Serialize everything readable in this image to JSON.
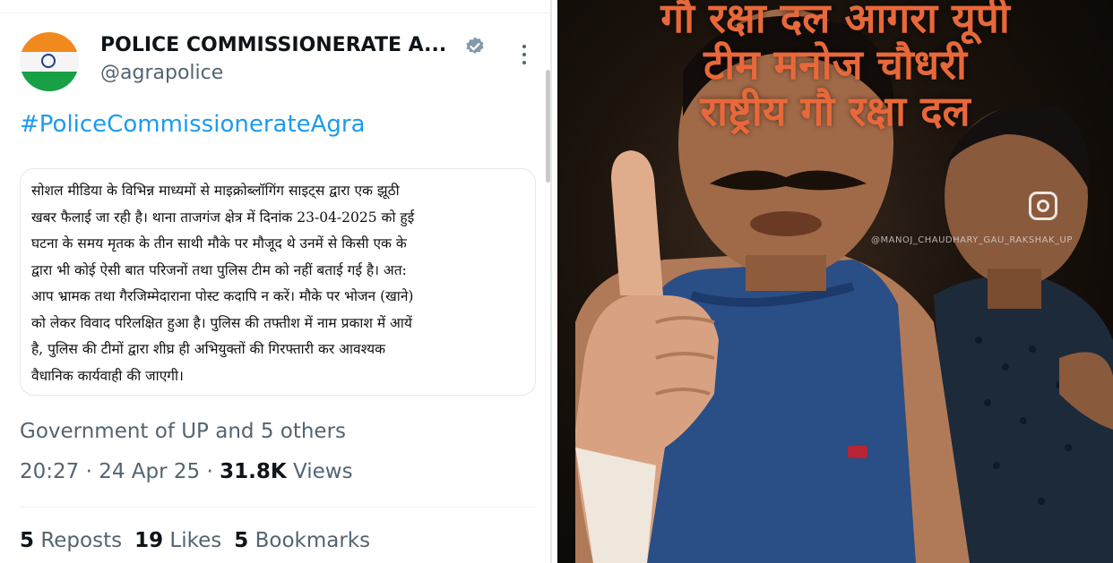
{
  "tweet": {
    "display_name": "POLICE COMMISSIONERATE A...",
    "handle": "@agrapolice",
    "hashtag": "#PoliceCommissionerateAgra",
    "attached_text": "सोशल मीडिया के विभिन्न माध्यमों से माइक्रोब्लॉगिंग साइट्स द्वारा एक झूठी\nखबर फैलाई जा रही है। थाना ताजगंज क्षेत्र में दिनांक 23-04-2025 को हुई\nघटना के समय मृतक के तीन साथी मौके पर मौजूद थे उनमें से किसी एक के\nद्वारा भी कोई ऐसी बात परिजनों तथा पुलिस टीम को नहीं बताई गई है। अत:\nआप भ्रामक तथा गैरजिम्मेदाराना पोस्ट कदापि न करें। मौके पर भोजन (खाने)\nको लेकर विवाद परिलक्षित हुआ है। पुलिस की तफ्तीश में नाम प्रकाश में आयें\nहै, पुलिस की टीमों द्वारा शीघ्र ही अभियुक्तों की गिरफ्तारी कर आवश्यक\nवैधानिक कार्यवाही की जाएगी।",
    "context": "Government of UP and 5 others",
    "time": "20:27",
    "date": "24 Apr 25",
    "separator": " · ",
    "views_count": "31.8K",
    "views_label": " Views",
    "reposts_count": "5",
    "reposts_label": " Reposts",
    "likes_count": "19",
    "likes_label": " Likes",
    "bookmarks_count": "5",
    "bookmarks_label": " Bookmarks",
    "icons": [
      "verified-badge-icon",
      "more-options-icon"
    ],
    "colors": {
      "link": "#1d9bf0",
      "secondary": "#536471",
      "primary": "#0f1419"
    }
  },
  "video": {
    "overlay_line1": "गौ रक्षा दल आगरा यूपी",
    "overlay_line2": "टीम मनोज चौधरी",
    "overlay_line3": "राष्ट्रीय गौ रक्षा दल",
    "watermark": "@MANOJ_CHAUDHARY_GAU_RAKSHAK_UP",
    "icons": [
      "instagram-icon"
    ],
    "colors": {
      "overlay_text": "#e8683a"
    }
  }
}
